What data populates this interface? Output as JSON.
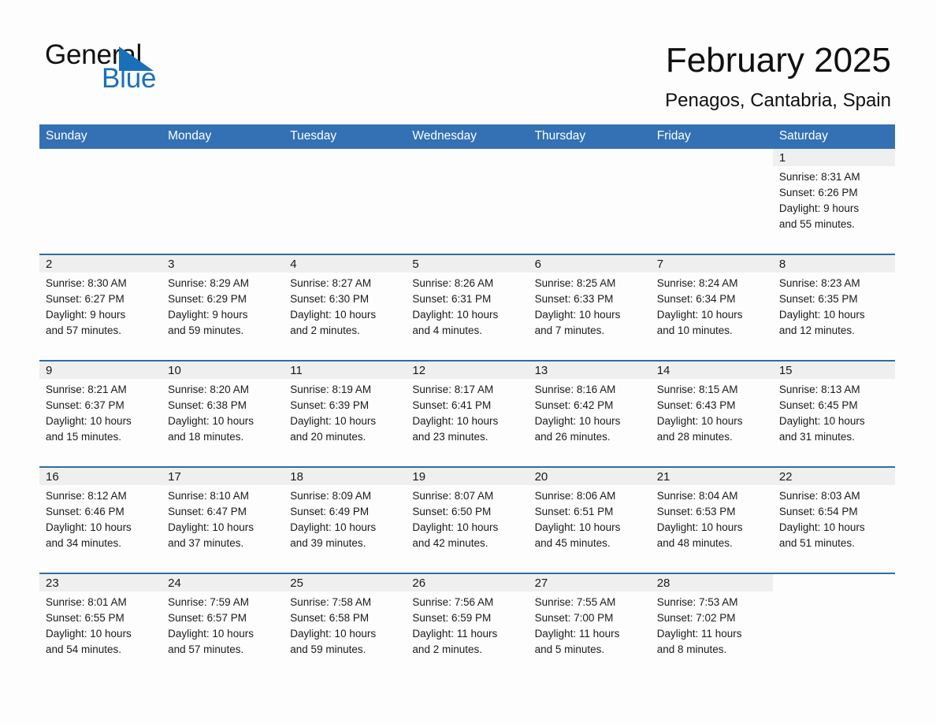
{
  "brand": {
    "name_part1": "General",
    "name_part2": "Blue",
    "triangle_color": "#1a70b8"
  },
  "header": {
    "title": "February 2025",
    "subtitle": "Penagos, Cantabria, Spain"
  },
  "theme": {
    "header_blue": "#3371b4",
    "rule_blue": "#2e6da4",
    "daynum_band": "#efefef",
    "page_background": "#fdfdfd"
  },
  "weekday_headers": [
    "Sunday",
    "Monday",
    "Tuesday",
    "Wednesday",
    "Thursday",
    "Friday",
    "Saturday"
  ],
  "weeks": [
    [
      {
        "day": "",
        "blank": true,
        "sunrise": "",
        "sunset": "",
        "daylight_line1": "",
        "daylight_line2": ""
      },
      {
        "day": "",
        "blank": true,
        "sunrise": "",
        "sunset": "",
        "daylight_line1": "",
        "daylight_line2": ""
      },
      {
        "day": "",
        "blank": true,
        "sunrise": "",
        "sunset": "",
        "daylight_line1": "",
        "daylight_line2": ""
      },
      {
        "day": "",
        "blank": true,
        "sunrise": "",
        "sunset": "",
        "daylight_line1": "",
        "daylight_line2": ""
      },
      {
        "day": "",
        "blank": true,
        "sunrise": "",
        "sunset": "",
        "daylight_line1": "",
        "daylight_line2": ""
      },
      {
        "day": "",
        "blank": true,
        "sunrise": "",
        "sunset": "",
        "daylight_line1": "",
        "daylight_line2": ""
      },
      {
        "day": "1",
        "sunrise": "Sunrise: 8:31 AM",
        "sunset": "Sunset: 6:26 PM",
        "daylight_line1": "Daylight: 9 hours",
        "daylight_line2": "and 55 minutes."
      }
    ],
    [
      {
        "day": "2",
        "sunrise": "Sunrise: 8:30 AM",
        "sunset": "Sunset: 6:27 PM",
        "daylight_line1": "Daylight: 9 hours",
        "daylight_line2": "and 57 minutes."
      },
      {
        "day": "3",
        "sunrise": "Sunrise: 8:29 AM",
        "sunset": "Sunset: 6:29 PM",
        "daylight_line1": "Daylight: 9 hours",
        "daylight_line2": "and 59 minutes."
      },
      {
        "day": "4",
        "sunrise": "Sunrise: 8:27 AM",
        "sunset": "Sunset: 6:30 PM",
        "daylight_line1": "Daylight: 10 hours",
        "daylight_line2": "and 2 minutes."
      },
      {
        "day": "5",
        "sunrise": "Sunrise: 8:26 AM",
        "sunset": "Sunset: 6:31 PM",
        "daylight_line1": "Daylight: 10 hours",
        "daylight_line2": "and 4 minutes."
      },
      {
        "day": "6",
        "sunrise": "Sunrise: 8:25 AM",
        "sunset": "Sunset: 6:33 PM",
        "daylight_line1": "Daylight: 10 hours",
        "daylight_line2": "and 7 minutes."
      },
      {
        "day": "7",
        "sunrise": "Sunrise: 8:24 AM",
        "sunset": "Sunset: 6:34 PM",
        "daylight_line1": "Daylight: 10 hours",
        "daylight_line2": "and 10 minutes."
      },
      {
        "day": "8",
        "sunrise": "Sunrise: 8:23 AM",
        "sunset": "Sunset: 6:35 PM",
        "daylight_line1": "Daylight: 10 hours",
        "daylight_line2": "and 12 minutes."
      }
    ],
    [
      {
        "day": "9",
        "sunrise": "Sunrise: 8:21 AM",
        "sunset": "Sunset: 6:37 PM",
        "daylight_line1": "Daylight: 10 hours",
        "daylight_line2": "and 15 minutes."
      },
      {
        "day": "10",
        "sunrise": "Sunrise: 8:20 AM",
        "sunset": "Sunset: 6:38 PM",
        "daylight_line1": "Daylight: 10 hours",
        "daylight_line2": "and 18 minutes."
      },
      {
        "day": "11",
        "sunrise": "Sunrise: 8:19 AM",
        "sunset": "Sunset: 6:39 PM",
        "daylight_line1": "Daylight: 10 hours",
        "daylight_line2": "and 20 minutes."
      },
      {
        "day": "12",
        "sunrise": "Sunrise: 8:17 AM",
        "sunset": "Sunset: 6:41 PM",
        "daylight_line1": "Daylight: 10 hours",
        "daylight_line2": "and 23 minutes."
      },
      {
        "day": "13",
        "sunrise": "Sunrise: 8:16 AM",
        "sunset": "Sunset: 6:42 PM",
        "daylight_line1": "Daylight: 10 hours",
        "daylight_line2": "and 26 minutes."
      },
      {
        "day": "14",
        "sunrise": "Sunrise: 8:15 AM",
        "sunset": "Sunset: 6:43 PM",
        "daylight_line1": "Daylight: 10 hours",
        "daylight_line2": "and 28 minutes."
      },
      {
        "day": "15",
        "sunrise": "Sunrise: 8:13 AM",
        "sunset": "Sunset: 6:45 PM",
        "daylight_line1": "Daylight: 10 hours",
        "daylight_line2": "and 31 minutes."
      }
    ],
    [
      {
        "day": "16",
        "sunrise": "Sunrise: 8:12 AM",
        "sunset": "Sunset: 6:46 PM",
        "daylight_line1": "Daylight: 10 hours",
        "daylight_line2": "and 34 minutes."
      },
      {
        "day": "17",
        "sunrise": "Sunrise: 8:10 AM",
        "sunset": "Sunset: 6:47 PM",
        "daylight_line1": "Daylight: 10 hours",
        "daylight_line2": "and 37 minutes."
      },
      {
        "day": "18",
        "sunrise": "Sunrise: 8:09 AM",
        "sunset": "Sunset: 6:49 PM",
        "daylight_line1": "Daylight: 10 hours",
        "daylight_line2": "and 39 minutes."
      },
      {
        "day": "19",
        "sunrise": "Sunrise: 8:07 AM",
        "sunset": "Sunset: 6:50 PM",
        "daylight_line1": "Daylight: 10 hours",
        "daylight_line2": "and 42 minutes."
      },
      {
        "day": "20",
        "sunrise": "Sunrise: 8:06 AM",
        "sunset": "Sunset: 6:51 PM",
        "daylight_line1": "Daylight: 10 hours",
        "daylight_line2": "and 45 minutes."
      },
      {
        "day": "21",
        "sunrise": "Sunrise: 8:04 AM",
        "sunset": "Sunset: 6:53 PM",
        "daylight_line1": "Daylight: 10 hours",
        "daylight_line2": "and 48 minutes."
      },
      {
        "day": "22",
        "sunrise": "Sunrise: 8:03 AM",
        "sunset": "Sunset: 6:54 PM",
        "daylight_line1": "Daylight: 10 hours",
        "daylight_line2": "and 51 minutes."
      }
    ],
    [
      {
        "day": "23",
        "sunrise": "Sunrise: 8:01 AM",
        "sunset": "Sunset: 6:55 PM",
        "daylight_line1": "Daylight: 10 hours",
        "daylight_line2": "and 54 minutes."
      },
      {
        "day": "24",
        "sunrise": "Sunrise: 7:59 AM",
        "sunset": "Sunset: 6:57 PM",
        "daylight_line1": "Daylight: 10 hours",
        "daylight_line2": "and 57 minutes."
      },
      {
        "day": "25",
        "sunrise": "Sunrise: 7:58 AM",
        "sunset": "Sunset: 6:58 PM",
        "daylight_line1": "Daylight: 10 hours",
        "daylight_line2": "and 59 minutes."
      },
      {
        "day": "26",
        "sunrise": "Sunrise: 7:56 AM",
        "sunset": "Sunset: 6:59 PM",
        "daylight_line1": "Daylight: 11 hours",
        "daylight_line2": "and 2 minutes."
      },
      {
        "day": "27",
        "sunrise": "Sunrise: 7:55 AM",
        "sunset": "Sunset: 7:00 PM",
        "daylight_line1": "Daylight: 11 hours",
        "daylight_line2": "and 5 minutes."
      },
      {
        "day": "28",
        "sunrise": "Sunrise: 7:53 AM",
        "sunset": "Sunset: 7:02 PM",
        "daylight_line1": "Daylight: 11 hours",
        "daylight_line2": "and 8 minutes."
      },
      {
        "day": "",
        "blank": true,
        "sunrise": "",
        "sunset": "",
        "daylight_line1": "",
        "daylight_line2": ""
      }
    ]
  ]
}
